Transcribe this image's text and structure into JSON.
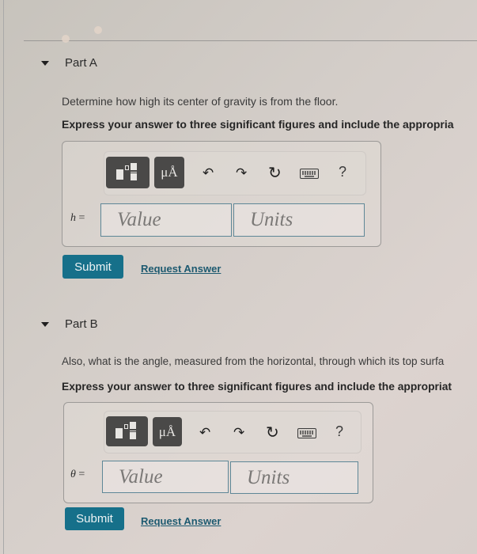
{
  "parts": [
    {
      "title": "Part A",
      "question": "Determine how high its center of gravity is from the floor.",
      "instruction": "Express your answer to three significant figures and include the appropria",
      "variable": "h",
      "equals": "=",
      "value_placeholder": "Value",
      "units_placeholder": "Units",
      "submit_label": "Submit",
      "request_label": "Request Answer"
    },
    {
      "title": "Part B",
      "question": "Also, what is the angle, measured from the horizontal, through which its top surfa",
      "instruction": "Express your answer to three significant figures and include the appropriat",
      "variable": "θ",
      "equals": "=",
      "value_placeholder": "Value",
      "units_placeholder": "Units",
      "submit_label": "Submit",
      "request_label": "Request Answer"
    }
  ],
  "toolbar": {
    "units_button_label": "μÅ",
    "undo_icon": "↶",
    "redo_icon": "↷",
    "reset_icon": "↻",
    "help_label": "?"
  },
  "colors": {
    "accent": "#16708a",
    "link": "#1d5a70",
    "field_border": "#5e8797",
    "toolbar_button": "#4a4948"
  }
}
